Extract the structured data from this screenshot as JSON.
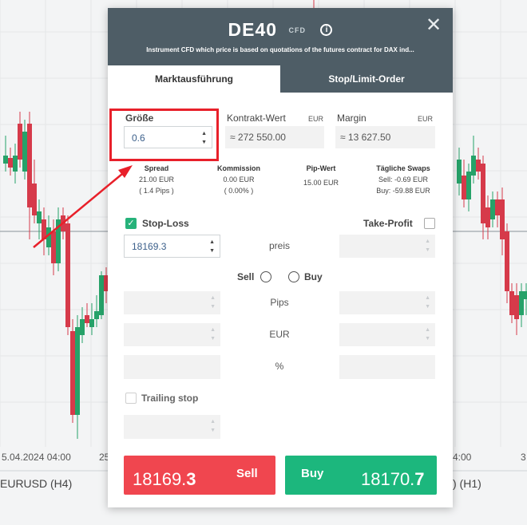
{
  "background": {
    "date_left": "5.04.2024 04:00",
    "date_mid": "25",
    "date_right_a": "4:00",
    "date_right_b": "3",
    "label_left": "EURUSD (H4)",
    "label_right": ") (H1)"
  },
  "modal": {
    "title": "DE40",
    "badge": "CFD",
    "info_icon": "i",
    "close_icon": "✕",
    "subtitle": "Instrument CFD which price is based on quotations of the futures contract for DAX ind...",
    "tabs": [
      "Marktausführung",
      "Stop/Limit-Order"
    ],
    "size": {
      "label": "Größe",
      "value": "0.6"
    },
    "contract_value": {
      "label": "Kontrakt-Wert",
      "currency": "EUR",
      "value": "≈ 272 550.00"
    },
    "margin": {
      "label": "Margin",
      "currency": "EUR",
      "value": "≈ 13 627.50"
    },
    "spread": {
      "label": "Spread",
      "value": "21.00 EUR",
      "sub": "( 1.4 Pips )"
    },
    "commission": {
      "label": "Kommission",
      "value": "0.00 EUR",
      "sub": "( 0.00% )"
    },
    "pip_value": {
      "label": "Pip-Wert",
      "value": "15.00 EUR"
    },
    "swaps": {
      "label": "Tägliche Swaps",
      "sell": "Sell: -0.69 EUR",
      "buy": "Buy: -59.88 EUR"
    },
    "stop_loss": {
      "label": "Stop-Loss",
      "checked": true,
      "value": "18169.3"
    },
    "take_profit": {
      "label": "Take-Profit",
      "checked": false
    },
    "price_label": "preis",
    "side": {
      "sell": "Sell",
      "buy": "Buy"
    },
    "pips_label": "Pips",
    "eur_label": "EUR",
    "percent_label": "%",
    "trailing_stop": {
      "label": "Trailing stop",
      "checked": false
    },
    "sell_button": {
      "label": "Sell",
      "price_main": "18169.",
      "price_big": "3"
    },
    "buy_button": {
      "label": "Buy",
      "price_main": "18170.",
      "price_big": "7"
    }
  },
  "colors": {
    "header": "#4e5d66",
    "sell": "#f0464f",
    "buy": "#1cb77d",
    "annotation": "#e8202a",
    "candle_up": "#26a269",
    "candle_down": "#d63a4a"
  }
}
